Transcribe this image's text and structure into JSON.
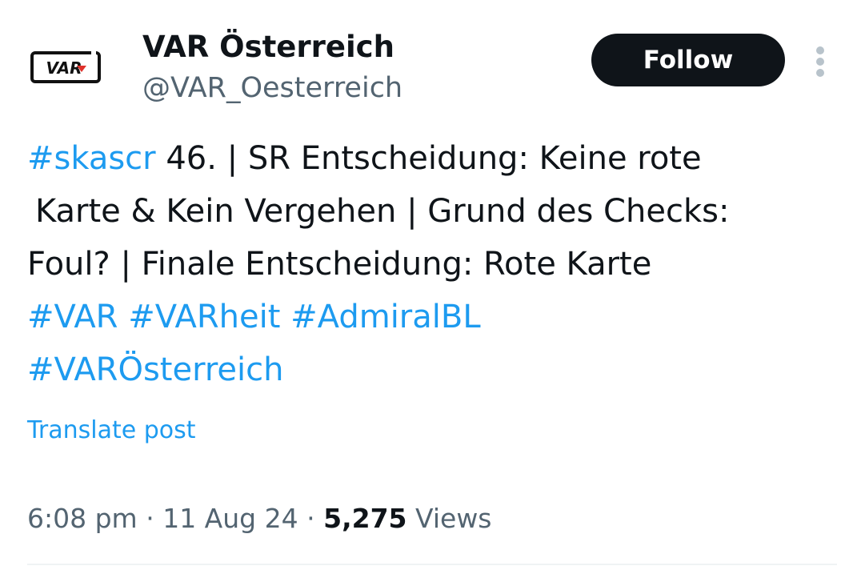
{
  "author": {
    "avatar_text": "VAR",
    "display_name": "VAR Österreich",
    "handle": "@VAR_Oesterreich"
  },
  "actions": {
    "follow_label": "Follow",
    "more_icon": "more-vertical-icon"
  },
  "post": {
    "lines": [
      [
        {
          "type": "hashtag",
          "text": "#skascr"
        },
        {
          "type": "text",
          "text": " 46. | SR Entscheidung: Keine rote"
        }
      ],
      [
        {
          "type": "text",
          "text": "Karte & Kein Vergehen | Grund des Checks:"
        }
      ],
      [
        {
          "type": "text",
          "text": "Foul? | Finale Entscheidung: Rote Karte"
        }
      ],
      [
        {
          "type": "hashtag",
          "text": "#VAR"
        },
        {
          "type": "text",
          "text": " "
        },
        {
          "type": "hashtag",
          "text": "#VARheit"
        },
        {
          "type": "text",
          "text": " "
        },
        {
          "type": "hashtag",
          "text": "#AdmiralBL"
        }
      ],
      [
        {
          "type": "hashtag",
          "text": "#VARÖsterreich"
        }
      ]
    ],
    "translate_label": "Translate post"
  },
  "meta": {
    "time": "6:08 pm",
    "separator": "·",
    "date": "11 Aug 24",
    "views_count": "5,275",
    "views_label": "Views"
  },
  "colors": {
    "link": "#1d9bf0",
    "text": "#0f1419",
    "secondary": "#536471",
    "logo_accent": "#e0312b"
  }
}
